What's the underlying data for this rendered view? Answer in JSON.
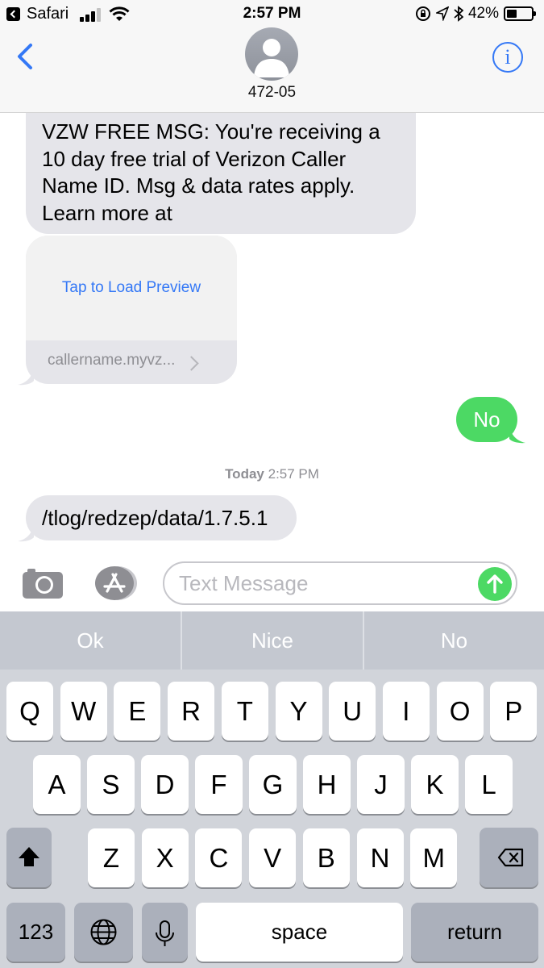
{
  "status_bar": {
    "back_app": "Safari",
    "time": "2:57 PM",
    "battery_percent": "42%",
    "battery_level": 0.42,
    "signal_bars_active": 3,
    "icons": [
      "lock-rotation-icon",
      "location-arrow-icon",
      "bluetooth-icon"
    ]
  },
  "header": {
    "contact_name": "472-05",
    "info_label": "i"
  },
  "messages": {
    "incoming_1": "VZW FREE MSG: You're receiving a\n10 day free trial of Verizon Caller\nName ID. Msg & data rates apply.\nLearn more at",
    "link_preview": {
      "action": "Tap to Load Preview",
      "domain": "callername.myvz..."
    },
    "outgoing_1": "No",
    "timestamp_day": "Today",
    "timestamp_time": "2:57 PM",
    "incoming_2": "/tlog/redzep/data/1.7.5.1"
  },
  "composer": {
    "placeholder": "Text Message",
    "value": ""
  },
  "keyboard": {
    "suggestions": [
      "Ok",
      "Nice",
      "No"
    ],
    "row1": [
      "Q",
      "W",
      "E",
      "R",
      "T",
      "Y",
      "U",
      "I",
      "O",
      "P"
    ],
    "row2": [
      "A",
      "S",
      "D",
      "F",
      "G",
      "H",
      "J",
      "K",
      "L"
    ],
    "row3": [
      "Z",
      "X",
      "C",
      "V",
      "B",
      "N",
      "M"
    ],
    "numbers_label": "123",
    "space_label": "space",
    "return_label": "return"
  },
  "colors": {
    "accent_blue": "#3478f6",
    "sent_bubble": "#4cd964",
    "received_bubble": "#e5e5ea",
    "keyboard_bg": "#d1d4da"
  }
}
